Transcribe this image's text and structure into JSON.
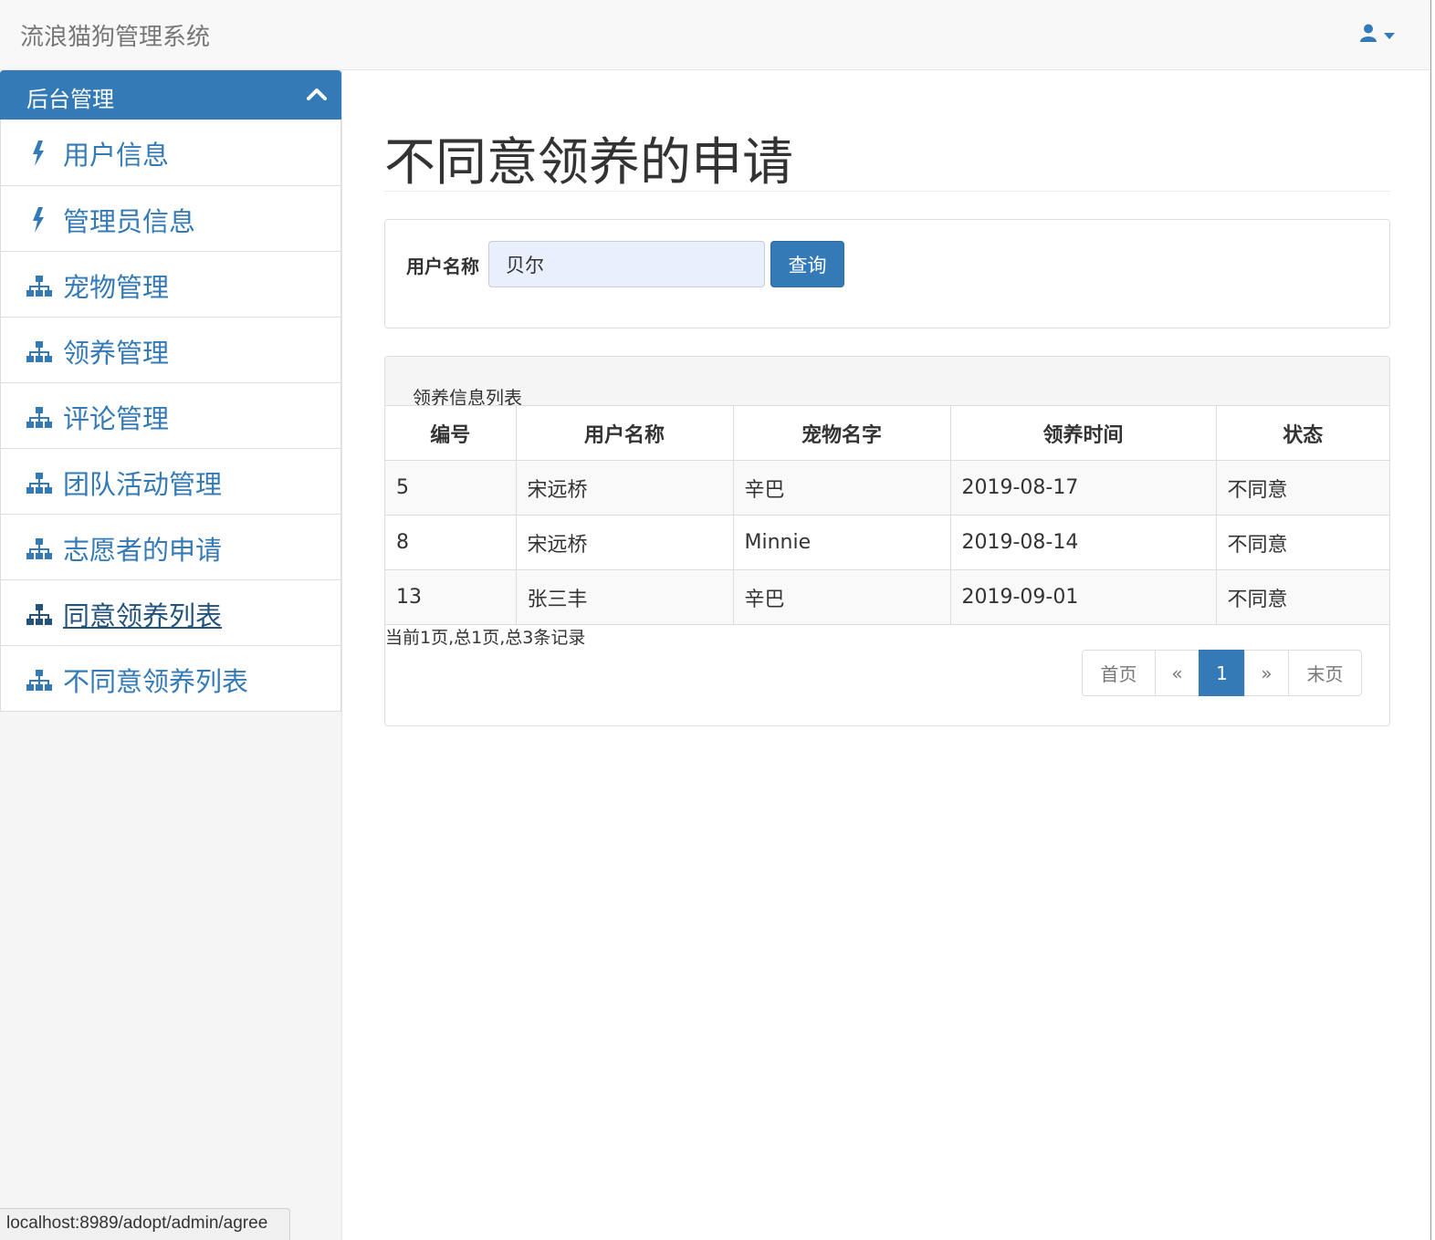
{
  "header": {
    "brand": "流浪猫狗管理系统",
    "user_icon": "user-icon",
    "caret_icon": "caret-down-icon"
  },
  "sidebar": {
    "heading": "后台管理",
    "heading_icon": "chevron-up-icon",
    "items": [
      {
        "label": "用户信息",
        "icon": "bolt-icon"
      },
      {
        "label": "管理员信息",
        "icon": "bolt-icon"
      },
      {
        "label": "宠物管理",
        "icon": "sitemap-icon"
      },
      {
        "label": "领养管理",
        "icon": "sitemap-icon"
      },
      {
        "label": "评论管理",
        "icon": "sitemap-icon"
      },
      {
        "label": "团队活动管理",
        "icon": "sitemap-icon"
      },
      {
        "label": "志愿者的申请",
        "icon": "sitemap-icon"
      },
      {
        "label": "同意领养列表",
        "icon": "sitemap-icon"
      },
      {
        "label": "不同意领养列表",
        "icon": "sitemap-icon"
      }
    ]
  },
  "main": {
    "title": "不同意领养的申请",
    "search": {
      "label": "用户名称",
      "value": "贝尔",
      "button": "查询"
    },
    "list": {
      "title": "领养信息列表",
      "columns": [
        "编号",
        "用户名称",
        "宠物名字",
        "领养时间",
        "状态"
      ],
      "rows": [
        [
          "5",
          "宋远桥",
          "辛巴",
          "2019-08-17",
          "不同意"
        ],
        [
          "8",
          "宋远桥",
          "Minnie",
          "2019-08-14",
          "不同意"
        ],
        [
          "13",
          "张三丰",
          "辛巴",
          "2019-09-01",
          "不同意"
        ]
      ],
      "page_info": "当前1页,总1页,总3条记录",
      "pager": {
        "first": "首页",
        "prev": "«",
        "current": "1",
        "next": "»",
        "last": "末页"
      }
    }
  },
  "status_bar": {
    "url": "localhost:8989/adopt/admin/agree"
  },
  "colors": {
    "primary": "#337ab7",
    "navbar_bg": "#f8f8f8",
    "sidebar_bg": "#f5f5f5"
  }
}
